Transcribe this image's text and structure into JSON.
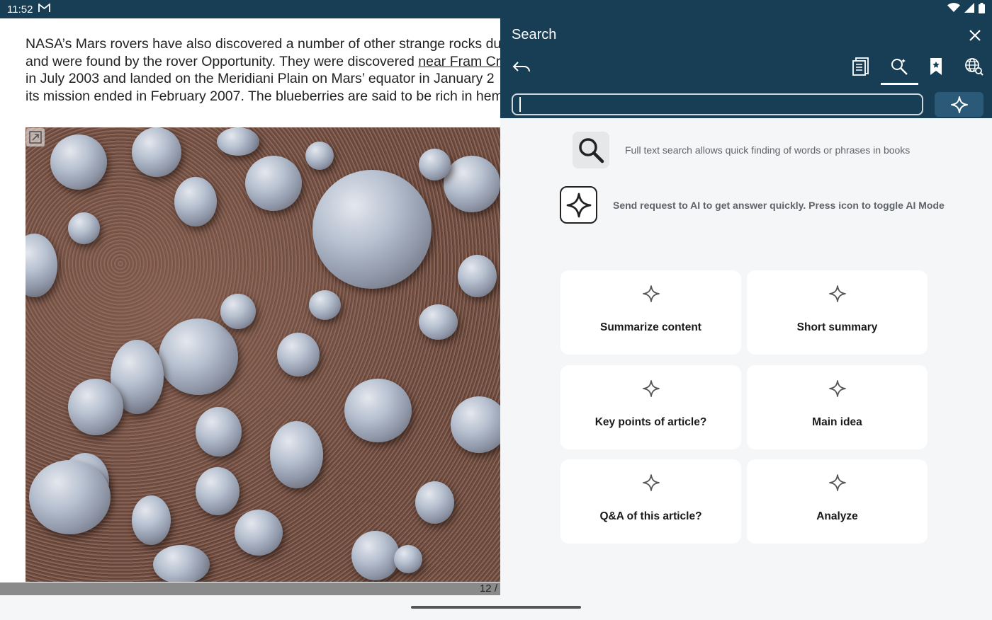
{
  "status_bar": {
    "time": "11:52"
  },
  "reader": {
    "lines": [
      "NASA’s Mars rovers have also discovered a number of other strange rocks du",
      "in July 2003 and landed on the Meridiani Plain on Mars’ equator in January 2",
      "its mission ended in February 2007. The blueberries are said to be rich in hem"
    ],
    "line2_before": "and were found by the rover Opportunity. They were discovered ",
    "line2_link": "near Fram Cra",
    "page_number": "12 /"
  },
  "search_panel": {
    "title": "Search",
    "search_input": {
      "value": "",
      "placeholder": ""
    },
    "hints": {
      "full_text": "Full text search allows quick finding of words or phrases in books",
      "ai": "Send request to AI to get answer quickly. Press icon to toggle AI Mode"
    },
    "suggestions": [
      {
        "label": "Summarize content"
      },
      {
        "label": "Short summary"
      },
      {
        "label": "Key points of article?"
      },
      {
        "label": "Main idea"
      },
      {
        "label": "Q&A of this article?"
      },
      {
        "label": "Analyze"
      }
    ],
    "tabs": [
      "contents-icon",
      "search-text-icon",
      "bookmark-icon",
      "web-search-icon"
    ]
  },
  "colors": {
    "header": "#173e55",
    "panel_bg": "#f5f6f7",
    "card_bg": "#ffffff",
    "accent": "#2a5a78"
  }
}
